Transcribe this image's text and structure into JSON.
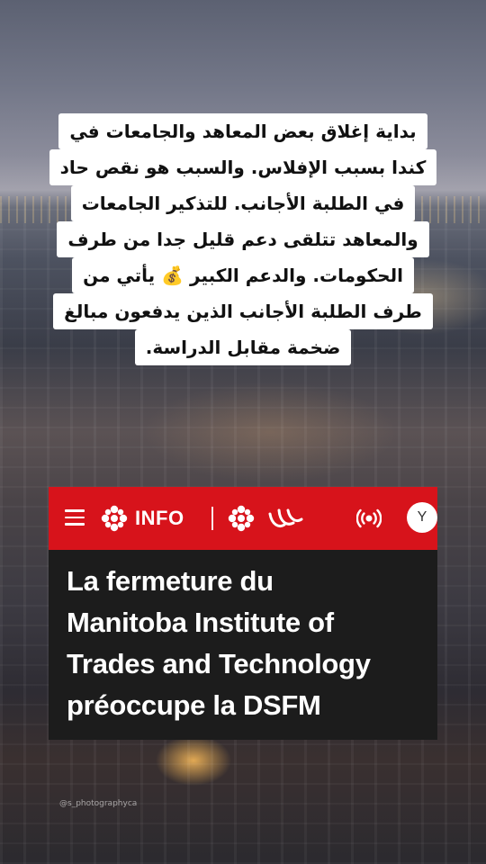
{
  "caption": {
    "lines": [
      "بداية إغلاق بعض المعاهد والجامعات في",
      "كندا بسبب الإفلاس. والسبب هو نقص حاد",
      "في الطلبة الأجانب. للتذكير الجامعات",
      "والمعاهد تتلقى دعم قليل جدا من طرف",
      "الحكومات. والدعم الكبير 💰 يأتي من",
      "طرف الطلبة الأجانب الذين يدفعون مبالغ",
      "ضخمة مقابل الدراسة."
    ]
  },
  "card": {
    "brand_color": "#d7131b",
    "nav_label": "INFO",
    "avatar_initial": "Y",
    "icons": [
      "menu-icon",
      "cbc-gem-icon",
      "cbc-gem-icon",
      "paralympic-icon",
      "live-radio-icon"
    ],
    "headline_lines": [
      "La fermeture du",
      "Manitoba Institute of",
      "Trades and Technology",
      "préoccupe la DSFM"
    ]
  },
  "watermark": "@s_photographyca"
}
